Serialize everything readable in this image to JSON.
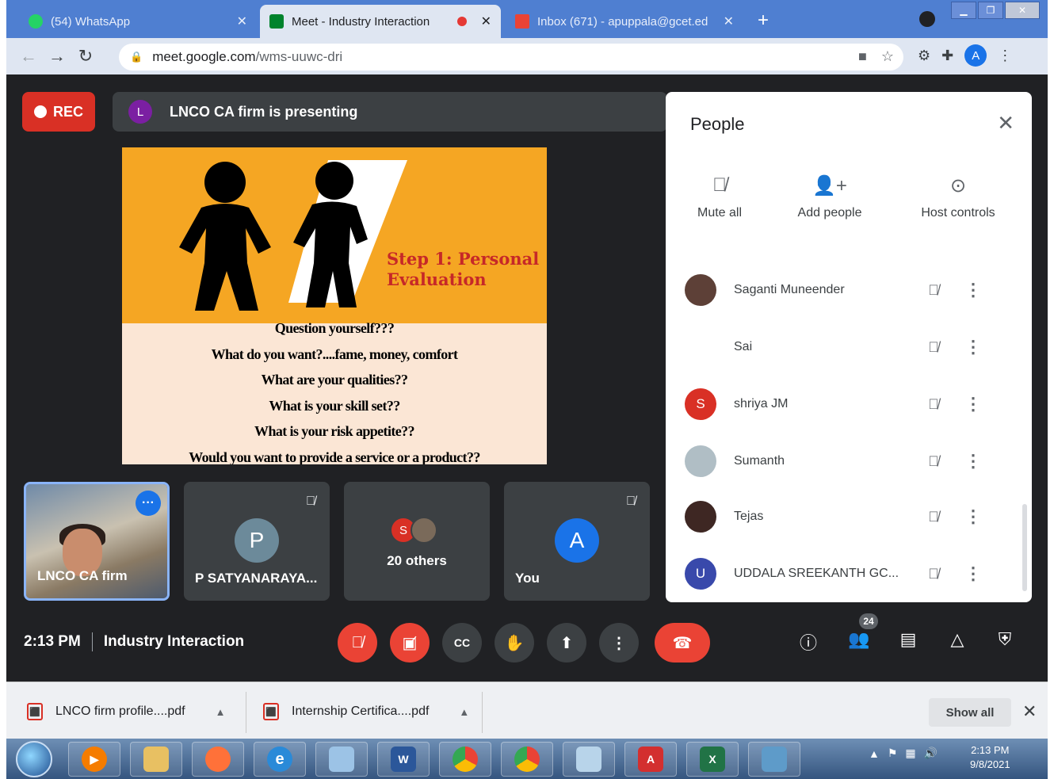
{
  "browser": {
    "tabs": [
      {
        "title": "(54) WhatsApp",
        "favicon_color": "#25d366",
        "active": false
      },
      {
        "title": "Meet - Industry Interaction",
        "favicon_color": "#00832d",
        "active": true,
        "recording": true
      },
      {
        "title": "Inbox (671) - apuppala@gcet.ed",
        "favicon_color": "#ea4335",
        "active": false
      }
    ],
    "new_tab": "+",
    "url_host": "meet.google.com",
    "url_path": "/wms-uuwc-dri",
    "profile_initial": "A"
  },
  "meet": {
    "rec_label": "REC",
    "presenter_initial": "L",
    "presenting_text": "LNCO CA firm is presenting",
    "slide": {
      "heading_line1": "Step 1: Personal",
      "heading_line2": "Evaluation",
      "lines": [
        "Question yourself???",
        "What do you want?....fame, money, comfort",
        "What are your qualities??",
        "What is your skill set??",
        "What is your risk appetite??",
        "Would you want to provide a service or a product??"
      ]
    },
    "tiles": [
      {
        "name": "LNCO CA firm"
      },
      {
        "name": "P SATYANARAYA...",
        "initial": "P",
        "color": "#6c8a9a"
      },
      {
        "name": "20 others",
        "initial": "S",
        "color": "#d93025"
      },
      {
        "name": "You",
        "initial": "A",
        "color": "#1a73e8"
      }
    ],
    "time": "2:13 PM",
    "meeting_title": "Industry Interaction",
    "participant_count": "24"
  },
  "people_panel": {
    "title": "People",
    "actions": [
      {
        "label": "Mute all",
        "icon": "mic-off-icon"
      },
      {
        "label": "Add people",
        "icon": "add-person-icon"
      },
      {
        "label": "Host controls",
        "icon": "toggle-icon"
      }
    ],
    "people": [
      {
        "name": "Saganti Muneender",
        "initial": "",
        "color": "#5d4037"
      },
      {
        "name": "Sai",
        "initial": "",
        "color": ""
      },
      {
        "name": "shriya JM",
        "initial": "S",
        "color": "#d93025"
      },
      {
        "name": "Sumanth",
        "initial": "",
        "color": "#b0bec5"
      },
      {
        "name": "Tejas",
        "initial": "",
        "color": "#3e2723"
      },
      {
        "name": "UDDALA SREEKANTH GC...",
        "initial": "U",
        "color": "#3949ab"
      }
    ]
  },
  "downloads": {
    "items": [
      {
        "name": "LNCO firm profile....pdf"
      },
      {
        "name": "Internship Certifica....pdf"
      }
    ],
    "show_all": "Show all"
  },
  "taskbar": {
    "time": "2:13 PM",
    "date": "9/8/2021"
  }
}
